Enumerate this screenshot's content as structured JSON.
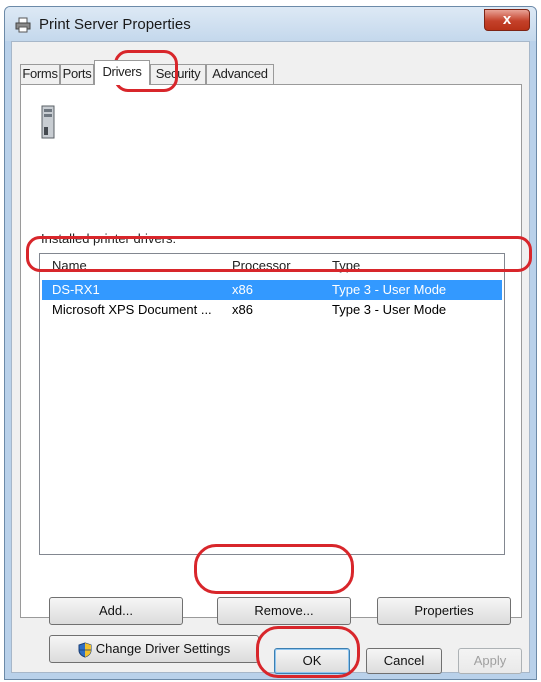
{
  "window": {
    "title": "Print Server Properties",
    "close_label": "x"
  },
  "tabs": [
    {
      "label": "Forms"
    },
    {
      "label": "Ports"
    },
    {
      "label": "Drivers"
    },
    {
      "label": "Security"
    },
    {
      "label": "Advanced"
    }
  ],
  "drivers": {
    "installed_label": "Installed printer drivers:",
    "columns": {
      "name": "Name",
      "processor": "Processor",
      "type": "Type"
    },
    "rows": [
      {
        "name": "DS-RX1",
        "processor": "x86",
        "type": "Type 3 - User Mode",
        "selected": true
      },
      {
        "name": "Microsoft XPS Document ...",
        "processor": "x86",
        "type": "Type 3 - User Mode",
        "selected": false
      }
    ]
  },
  "buttons": {
    "add": "Add...",
    "remove": "Remove...",
    "properties": "Properties",
    "change_driver_settings": "Change Driver Settings",
    "ok": "OK",
    "cancel": "Cancel",
    "apply": "Apply"
  },
  "colors": {
    "selection": "#3399ff",
    "annotation_highlight": "#d8262b"
  }
}
